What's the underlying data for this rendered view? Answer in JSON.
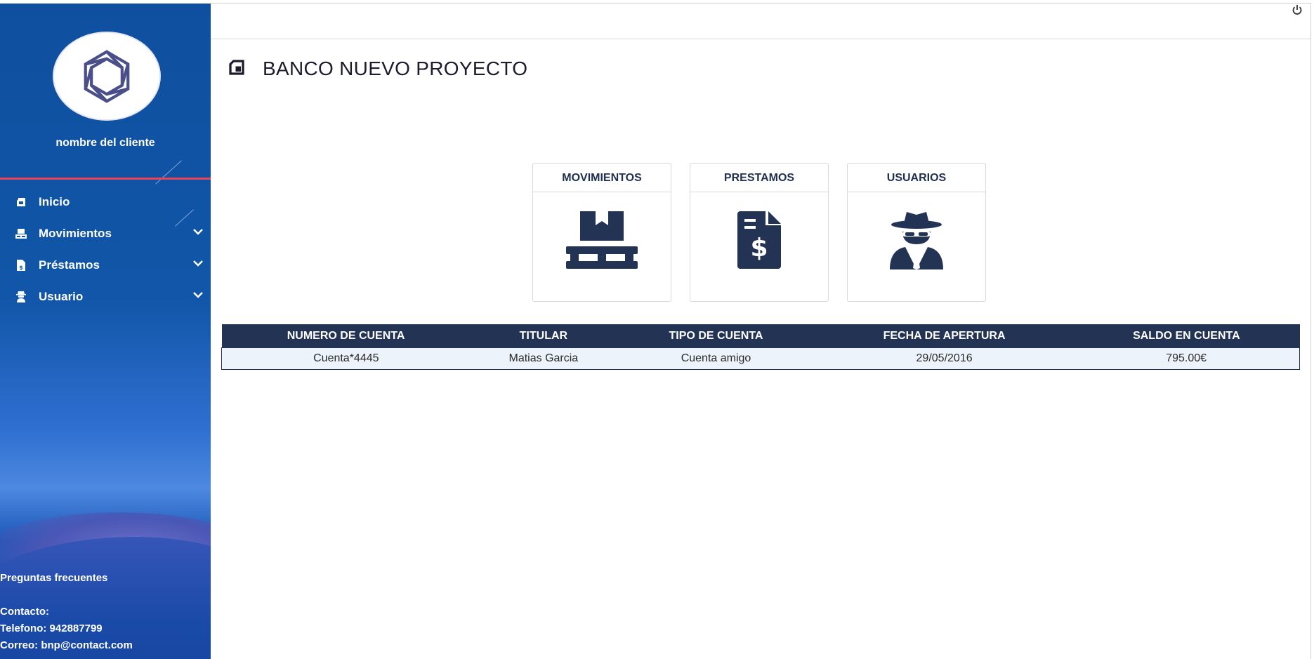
{
  "sidebar": {
    "client_name": "nombre del cliente",
    "items": [
      {
        "label": "Inicio",
        "icon": "tablet-icon",
        "has_submenu": false
      },
      {
        "label": "Movimientos",
        "icon": "pallet-icon",
        "has_submenu": true
      },
      {
        "label": "Préstamos",
        "icon": "invoice-dollar-icon",
        "has_submenu": true
      },
      {
        "label": "Usuario",
        "icon": "user-secret-icon",
        "has_submenu": true
      }
    ],
    "footer": {
      "faq": "Preguntas frecuentes",
      "contact": "Contacto:",
      "phone": "Telefono: 942887799",
      "email": "Correo: bnp@contact.com"
    }
  },
  "header": {
    "title": "BANCO NUEVO PROYECTO",
    "power_icon": "power-icon"
  },
  "cards": [
    {
      "label": "MOVIMIENTOS",
      "icon": "pallet-icon"
    },
    {
      "label": "PRESTAMOS",
      "icon": "invoice-dollar-icon"
    },
    {
      "label": "USUARIOS",
      "icon": "user-secret-icon"
    }
  ],
  "table": {
    "columns": [
      "NUMERO DE CUENTA",
      "TITULAR",
      "TIPO DE CUENTA",
      "FECHA DE APERTURA",
      "SALDO EN CUENTA"
    ],
    "rows": [
      [
        "Cuenta*4445",
        "Matias Garcia",
        "Cuenta amigo",
        "29/05/2016",
        "795.00€"
      ]
    ]
  },
  "colors": {
    "sidebar": "#1156a8",
    "accent_red": "#e8445a",
    "navy": "#233354",
    "row_bg": "#edf3fb"
  }
}
